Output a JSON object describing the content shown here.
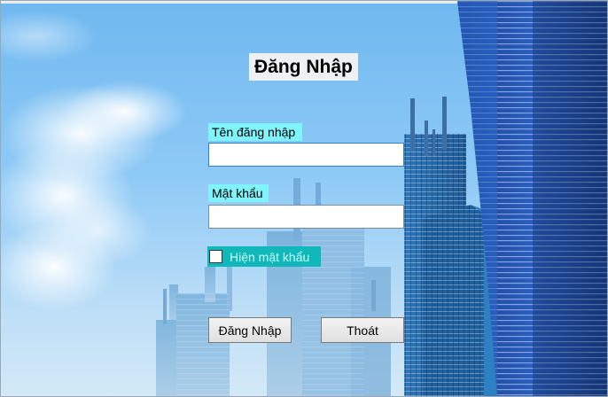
{
  "form": {
    "title": "Đăng Nhập",
    "username_label": "Tên đăng nhập",
    "username_value": "",
    "password_label": "Mật khẩu",
    "password_value": "",
    "show_password_label": "Hiện mật khẩu",
    "show_password_checked": false,
    "login_button": "Đăng Nhập",
    "exit_button": "Thoát"
  },
  "colors": {
    "label_background": "#7ff4fb",
    "checkbox_panel_background": "#10b8ba",
    "sky": "#8fcaf6"
  }
}
